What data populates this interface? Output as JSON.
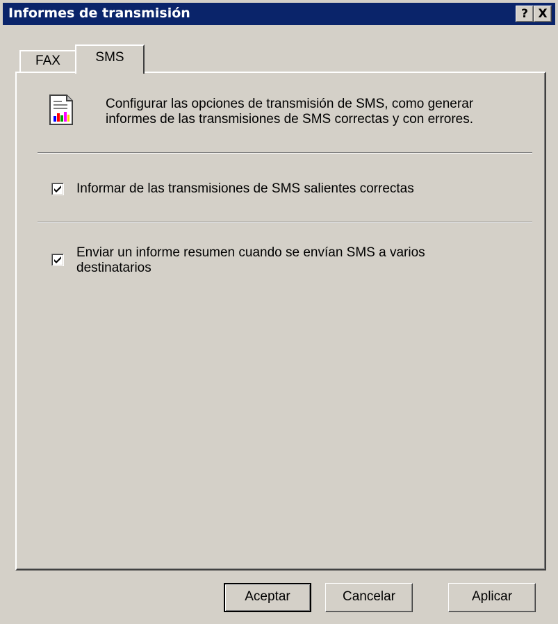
{
  "window": {
    "title": "Informes de transmisión",
    "help_button": "?",
    "close_button": "X"
  },
  "tabs": [
    {
      "label": "FAX",
      "selected": false
    },
    {
      "label": "SMS",
      "selected": true
    }
  ],
  "panel": {
    "icon": "report-document-icon",
    "description": "Configurar las opciones de transmisión de SMS, como generar\ninformes de las transmisiones de SMS correctas y con errores.",
    "options": [
      {
        "label": "Informar de las transmisiones de SMS salientes correctas",
        "checked": true
      },
      {
        "label": "Enviar un informe resumen cuando se envían SMS a varios destinatarios",
        "checked": true
      }
    ]
  },
  "buttons": {
    "ok": "Aceptar",
    "cancel": "Cancelar",
    "apply": "Aplicar"
  },
  "colors": {
    "titlebar": "#0a246a",
    "face": "#d4d0c8"
  }
}
